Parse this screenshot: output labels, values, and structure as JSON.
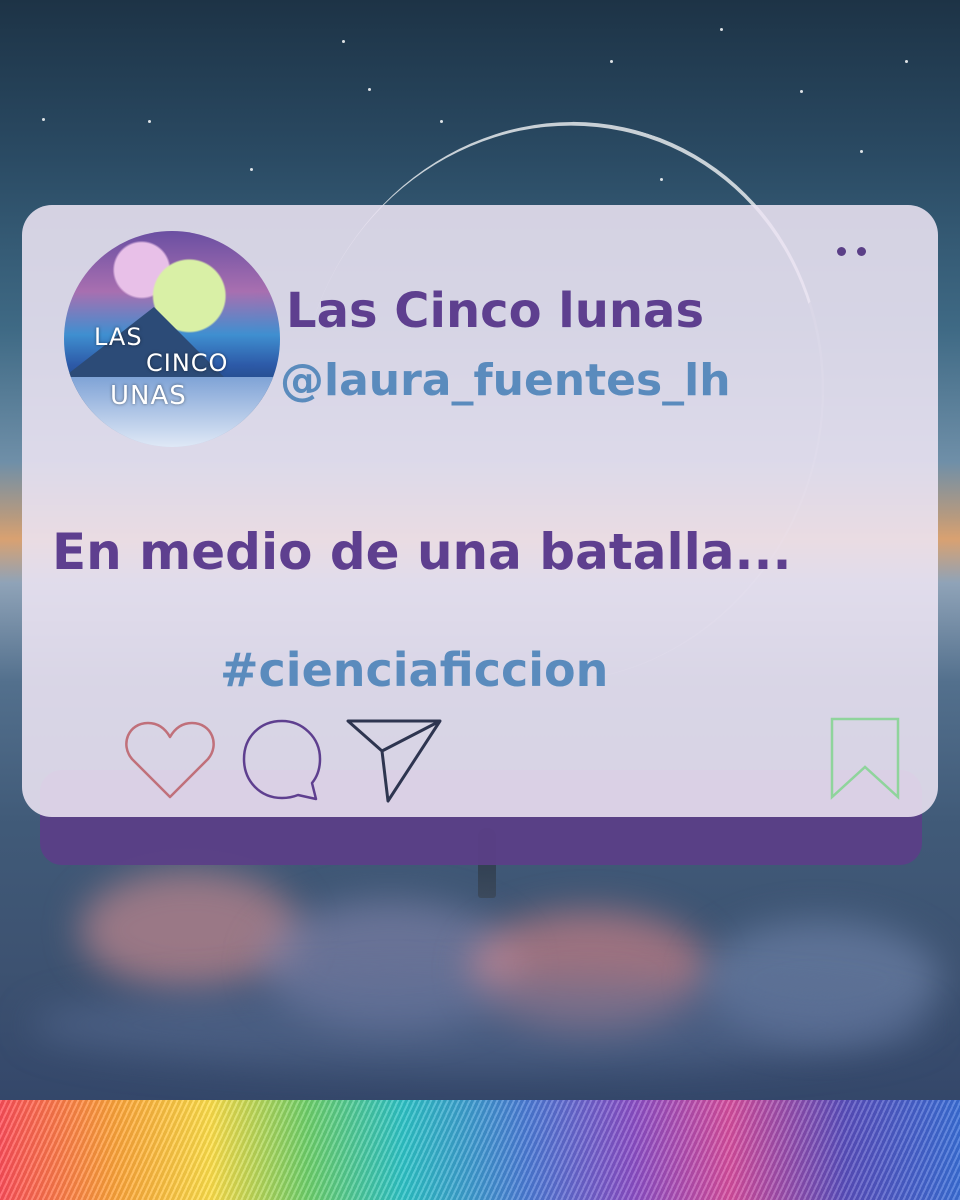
{
  "profile": {
    "display_name": "Las Cinco lunas",
    "handle": "@laura_fuentes_lh",
    "avatar_logo_lines": [
      "LAS",
      "CINCO",
      "UNAS"
    ]
  },
  "post": {
    "text": "En medio de una batalla...",
    "hashtag": "#cienciaficcion"
  },
  "actions": {
    "like_icon": "heart-icon",
    "comment_icon": "comment-bubble-icon",
    "share_icon": "paper-plane-icon",
    "bookmark_icon": "bookmark-icon"
  },
  "colors": {
    "name": "#5e3f8f",
    "handle": "#5a8bbd",
    "card": "#ece4f3",
    "like_stroke": "#c0707a",
    "comment_stroke": "#5e3f8f",
    "share_stroke": "#2e3550",
    "bookmark_stroke": "#8fd49c"
  }
}
